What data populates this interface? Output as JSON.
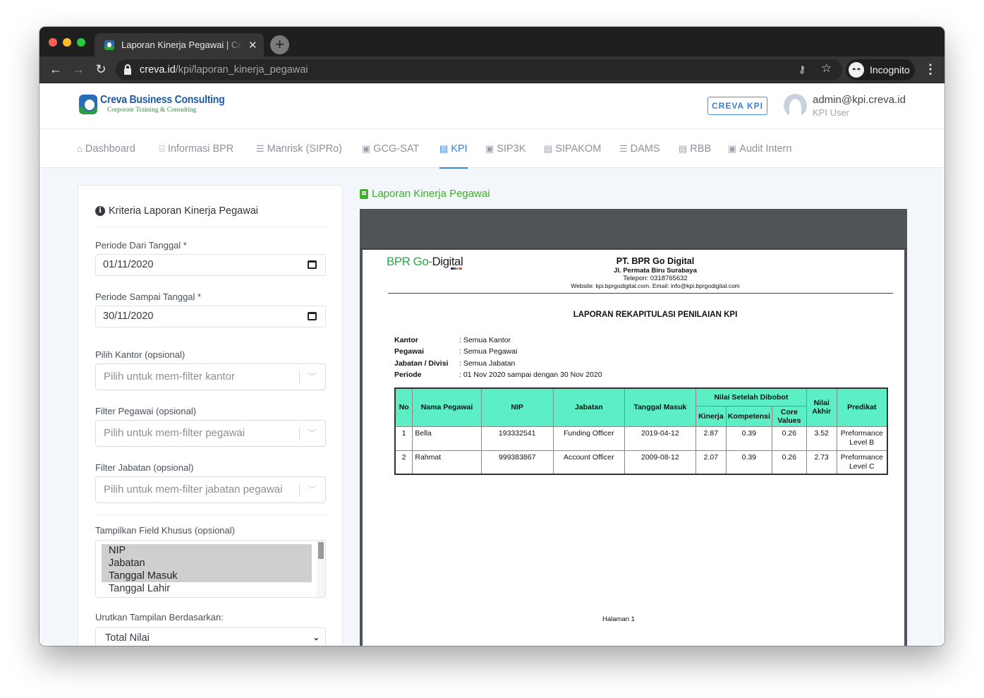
{
  "browser": {
    "tab_title": "Laporan Kinerja Pegawai | Creva KPI",
    "url_host": "creva.id",
    "url_path": "/kpi/laporan_kinerja_pegawai",
    "incognito_label": "Incognito"
  },
  "header": {
    "logo_title": "Creva Business Consulting",
    "logo_subtitle": "Corporate Training & Consulting",
    "app_button": "CREVA KPI",
    "user_email": "admin@kpi.creva.id",
    "user_role": "KPI User"
  },
  "nav": {
    "items": [
      {
        "label": "Dashboard",
        "icon": "home-icon",
        "glyph": "⌂"
      },
      {
        "label": "Informasi BPR",
        "icon": "bank-icon",
        "glyph": "🏛"
      },
      {
        "label": "Manrisk (SIPRo)",
        "icon": "list-check-icon",
        "glyph": "☰"
      },
      {
        "label": "GCG-SAT",
        "icon": "clipboard-check-icon",
        "glyph": "▣"
      },
      {
        "label": "KPI",
        "icon": "clipboard-list-icon",
        "glyph": "▤",
        "active": true
      },
      {
        "label": "SIP3K",
        "icon": "address-book-icon",
        "glyph": "▣"
      },
      {
        "label": "SIPAKOM",
        "icon": "book-icon",
        "glyph": "▤"
      },
      {
        "label": "DAMS",
        "icon": "list-check-icon",
        "glyph": "☰"
      },
      {
        "label": "RBB",
        "icon": "book-icon",
        "glyph": "▤"
      },
      {
        "label": "Audit Intern",
        "icon": "clipboard-check-icon",
        "glyph": "▣"
      }
    ]
  },
  "criteria": {
    "title": "Kriteria Laporan Kinerja Pegawai",
    "from_label": "Periode Dari Tanggal *",
    "from_value": "01/11/2020",
    "to_label": "Periode Sampai Tanggal *",
    "to_value": "30/11/2020",
    "kantor_label": "Pilih Kantor (opsional)",
    "kantor_placeholder": "Pilih untuk mem-filter kantor",
    "pegawai_label": "Filter Pegawai (opsional)",
    "pegawai_placeholder": "Pilih untuk mem-filter pegawai",
    "jabatan_label": "Filter Jabatan (opsional)",
    "jabatan_placeholder": "Pilih untuk mem-filter jabatan pegawai",
    "fields_label": "Tampilkan Field Khusus (opsional)",
    "fields_options": [
      {
        "label": "NIP",
        "selected": true
      },
      {
        "label": "Jabatan",
        "selected": true
      },
      {
        "label": "Tanggal Masuk",
        "selected": true
      },
      {
        "label": "Tanggal Lahir",
        "selected": false
      }
    ],
    "sort_label": "Urutkan Tampilan Berdasarkan:",
    "sort_value": "Total Nilai"
  },
  "report": {
    "heading": "Laporan Kinerja Pegawai",
    "logo_part1": "BPR Go-",
    "logo_part2": "Digital",
    "company_name": "PT. BPR Go Digital",
    "company_address": "Jl. Permata Biru Surabaya",
    "company_phone": "Telepon: 0318765632",
    "company_web": "Website: kpi.bprgodigital.com. Email: info@kpi.bprgodigital.com",
    "title": "LAPORAN REKAPITULASI PENILAIAN KPI",
    "meta": [
      {
        "key": "Kantor",
        "value": ": Semua Kantor"
      },
      {
        "key": "Pegawai",
        "value": ": Semua Pegawai"
      },
      {
        "key": "Jabatan / Divisi",
        "value": ": Semua Jabatan"
      },
      {
        "key": "Periode",
        "value": ": 01 Nov 2020 sampai dengan 30 Nov 2020"
      }
    ],
    "table": {
      "headers": {
        "no": "No",
        "nama": "Nama Pegawai",
        "nip": "NIP",
        "jabatan": "Jabatan",
        "tanggal": "Tanggal Masuk",
        "group": "Nilai Setelah Dibobot",
        "kinerja": "Kinerja",
        "kompetensi": "Kompetensi",
        "core": "Core Values",
        "akhir": "Nilai Akhir",
        "predikat": "Predikat"
      },
      "rows": [
        {
          "no": "1",
          "nama": "Bella",
          "nip": "193332541",
          "jabatan": "Funding Officer",
          "tanggal": "2019-04-12",
          "kinerja": "2.87",
          "kompetensi": "0.39",
          "core": "0.26",
          "akhir": "3.52",
          "predikat": "Preformance Level B"
        },
        {
          "no": "2",
          "nama": "Rahmat",
          "nip": "999383867",
          "jabatan": "Account Officer",
          "tanggal": "2009-08-12",
          "kinerja": "2.07",
          "kompetensi": "0.39",
          "core": "0.26",
          "akhir": "2.73",
          "predikat": "Preformance Level C"
        }
      ]
    },
    "page_label": "Halaman 1"
  }
}
